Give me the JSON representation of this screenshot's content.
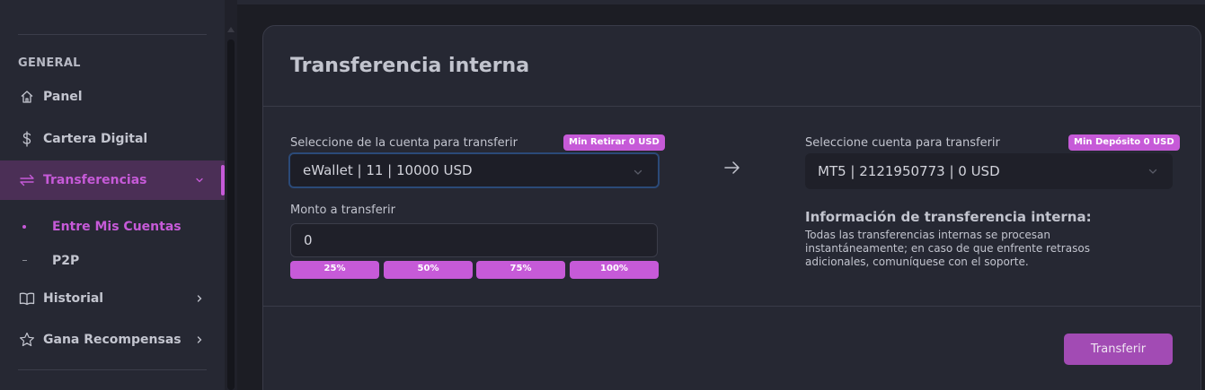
{
  "sidebar": {
    "section_heading": "GENERAL",
    "items": [
      {
        "label": "Panel",
        "icon": "home-icon"
      },
      {
        "label": "Cartera Digital",
        "icon": "dollar-icon"
      },
      {
        "label": "Transferencias",
        "icon": "transfer-icon",
        "active": true
      },
      {
        "label": "Historial",
        "icon": "book-icon"
      },
      {
        "label": "Gana Recompensas",
        "icon": "star-icon"
      }
    ],
    "subitems": [
      {
        "label": "Entre Mis Cuentas",
        "active": true
      },
      {
        "label": "P2P"
      }
    ]
  },
  "card": {
    "title": "Transferencia interna",
    "from": {
      "label": "Seleccione de la cuenta para transferir",
      "badge": "Min Retirar 0 USD",
      "selected": "eWallet | 11 | 10000 USD"
    },
    "amount": {
      "label": "Monto a transferir",
      "value": "0",
      "presets": [
        "25%",
        "50%",
        "75%",
        "100%"
      ]
    },
    "to": {
      "label": "Seleccione cuenta para transferir",
      "badge": "Min Depósito 0 USD",
      "selected": "MT5 | 2121950773 | 0 USD"
    },
    "info": {
      "title": "Información de transferencia interna:",
      "text": "Todas las transferencias internas se procesan instantáneamente; en caso de que enfrente retrasos adicionales, comuníquese con el soporte."
    },
    "submit_label": "Transferir"
  },
  "colors": {
    "accent": "#c65ad8",
    "button": "#a24bb4",
    "background": "#1c1d24",
    "panel": "#262833"
  }
}
